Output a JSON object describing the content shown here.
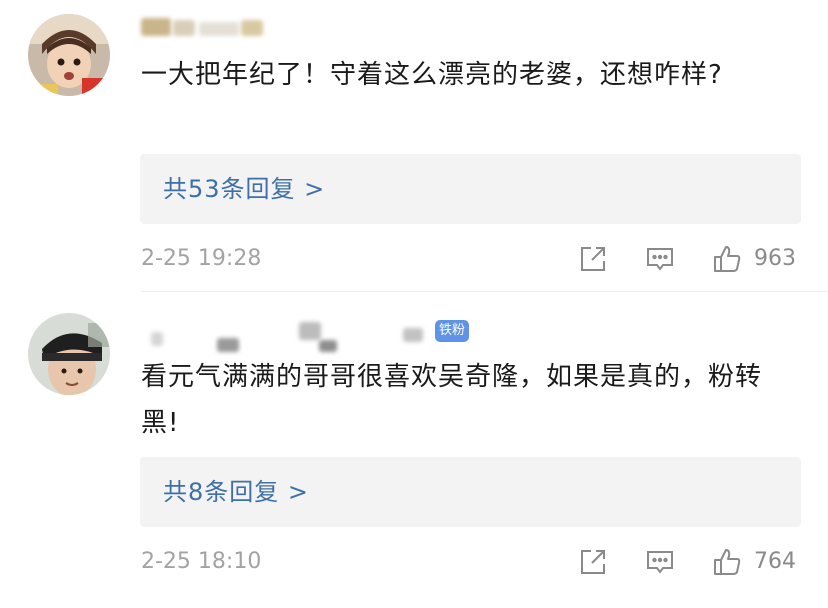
{
  "comments": [
    {
      "text": "一大把年纪了！守着这么漂亮的老婆，还想咋样?",
      "reply_summary": "共53条回复 >",
      "time": "2-25 19:28",
      "likes": "963",
      "badge": ""
    },
    {
      "text": "看元气满满的哥哥很喜欢吴奇隆，如果是真的，粉转黑!",
      "reply_summary": "共8条回复 >",
      "time": "2-25 18:10",
      "likes": "764",
      "badge": "铁粉"
    }
  ],
  "icons": {
    "share": "share-icon",
    "reply": "comment-icon",
    "like": "thumbs-up-icon"
  },
  "colors": {
    "reply_link": "#3d6fa8",
    "badge_bg": "#5f93e6",
    "meta_text": "#a3a3a3"
  }
}
